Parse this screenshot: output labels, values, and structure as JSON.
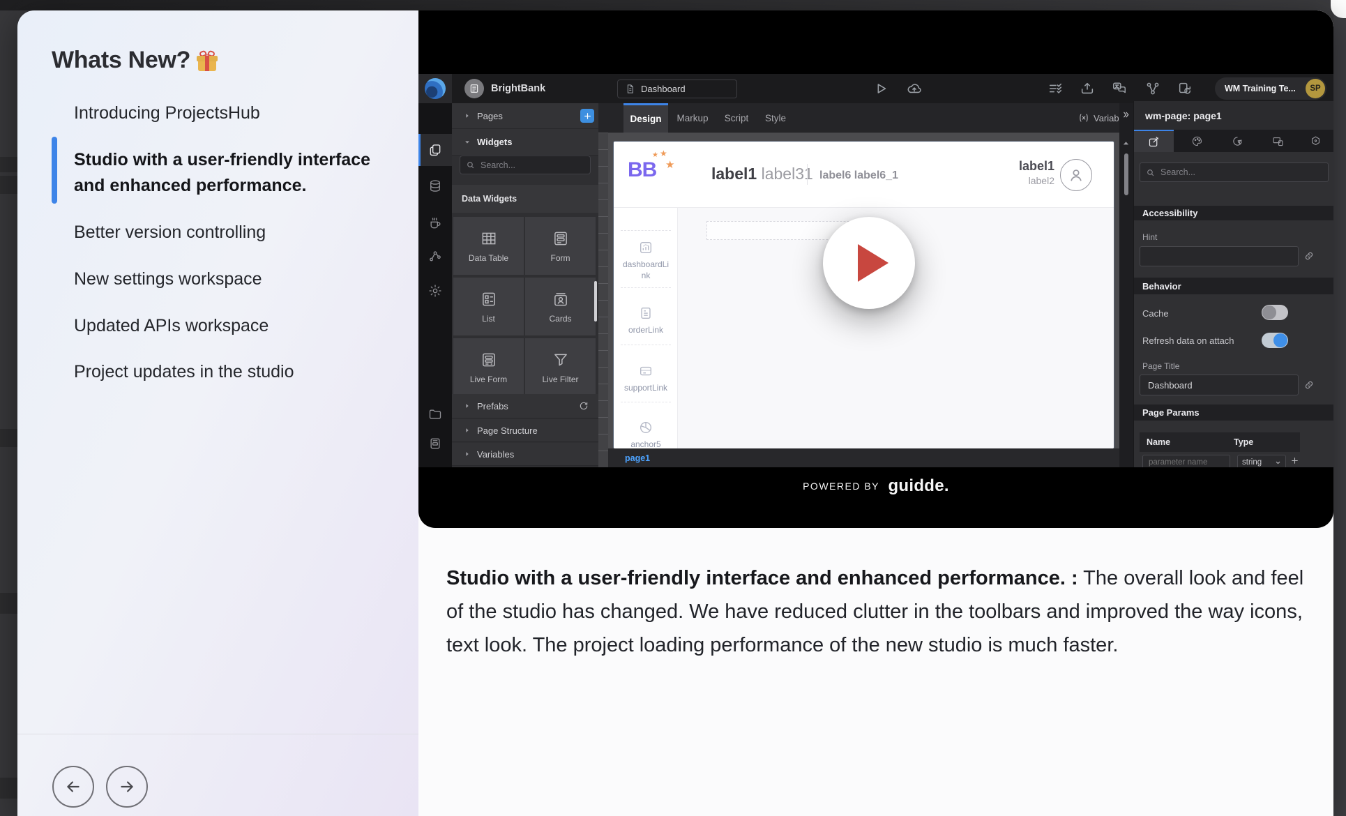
{
  "panel": {
    "title": "Whats New?",
    "items": [
      {
        "label": "Introducing ProjectsHub"
      },
      {
        "label": "Studio with a user-friendly interface and enhanced performance.",
        "line1": "Studio with a user-friendly interface",
        "line2": "and enhanced performance.",
        "selected": true
      },
      {
        "label": "Better version controlling"
      },
      {
        "label": "New settings workspace"
      },
      {
        "label": "Updated APIs workspace"
      },
      {
        "label": "Project updates in the studio"
      }
    ]
  },
  "video": {
    "powered_by": "POWERED BY",
    "brand": "guidde."
  },
  "description": {
    "bold": "Studio with a user-friendly interface and enhanced performance. :",
    "text": "  The overall look and feel of the studio has changed. We have reduced clutter in the toolbars and improved the way icons, text look. The project loading performance of the new studio is much faster."
  },
  "studio": {
    "topbar": {
      "project": "BrightBank",
      "page_tab": "Dashboard",
      "account": "WM Training Te...",
      "avatar_initials": "SP"
    },
    "left_panel": {
      "pages": "Pages",
      "widgets": "Widgets",
      "search_placeholder": "Search...",
      "section": "Data Widgets",
      "tiles": [
        "Data Table",
        "Form",
        "List",
        "Cards",
        "Live Form",
        "Live Filter"
      ],
      "rows": [
        "Prefabs",
        "Page Structure",
        "Variables"
      ]
    },
    "tabs": [
      "Design",
      "Markup",
      "Script",
      "Style"
    ],
    "toolbar": {
      "variables": "Variables"
    },
    "canvas": {
      "logo": "BB",
      "header_bold": "label1",
      "header_gray": "label31",
      "header_small": "label6 label6_1",
      "right_top": "label1",
      "right_bottom": "label2",
      "nav": [
        {
          "line1": "dashboardLi",
          "line2": "nk"
        },
        {
          "line1": "orderLink",
          "line2": ""
        },
        {
          "line1": "supportLink",
          "line2": ""
        },
        {
          "line1": "anchor5",
          "line2": ""
        }
      ],
      "page_tab": "page1"
    },
    "right_panel": {
      "title": "wm-page: page1",
      "search_placeholder": "Search...",
      "accessibility": "Accessibility",
      "hint": "Hint",
      "behavior": "Behavior",
      "cache": "Cache",
      "refresh": "Refresh data on attach",
      "page_title_label": "Page Title",
      "page_title_value": "Dashboard",
      "page_params": "Page Params",
      "col_name": "Name",
      "col_type": "Type",
      "param_placeholder": "parameter name",
      "type_value": "string"
    }
  },
  "colors": {
    "accent": "#3d84e8",
    "toggle_on": "#3f8fe8",
    "play_triangle": "#c8473f",
    "avatar_gold": "#b3973e",
    "page_link_blue": "#4da3ff"
  }
}
